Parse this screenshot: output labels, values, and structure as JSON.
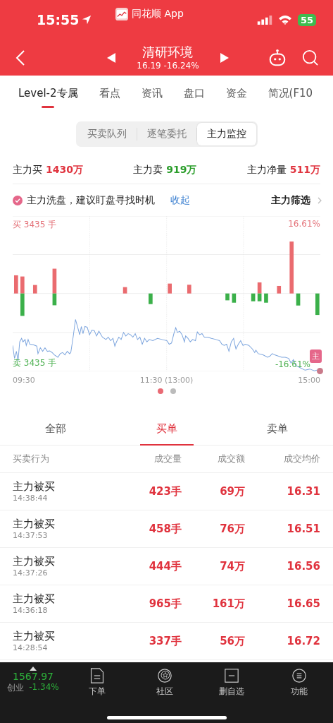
{
  "status_bar": {
    "time": "15:55",
    "app_name": "同花顺 App",
    "battery": "55"
  },
  "header": {
    "title": "清研环境",
    "price": "16.19",
    "change": "-16.24%"
  },
  "tabs": [
    {
      "label": "Level-2专属",
      "selected": true
    },
    {
      "label": "看点",
      "selected": false
    },
    {
      "label": "资讯",
      "selected": false
    },
    {
      "label": "盘口",
      "selected": false
    },
    {
      "label": "资金",
      "selected": false
    },
    {
      "label": "简况(F10",
      "selected": false
    }
  ],
  "segments": [
    {
      "label": "买卖队列",
      "selected": false
    },
    {
      "label": "逐笔委托",
      "selected": false
    },
    {
      "label": "主力监控",
      "selected": true
    }
  ],
  "summary": [
    {
      "label": "主力买",
      "value": "1430万",
      "color": "#e0333e"
    },
    {
      "label": "主力卖",
      "value": "919万",
      "color": "#2a9d2a"
    },
    {
      "label": "主力净量",
      "value": "511万",
      "color": "#e0333e"
    }
  ],
  "tip": {
    "text": "主力洗盘，建议盯盘寻找时机",
    "link": "收起",
    "filter": "主力筛选"
  },
  "chart": {
    "buy_label": "买 3435 手",
    "top_pct": "16.61%",
    "sell_label": "卖 3435 手",
    "bottom_pct": "-16.61%",
    "badge": "主",
    "x_labels": [
      "09:30",
      "11:30 (13:00)",
      "15:00"
    ]
  },
  "chart_pager": [
    {
      "selected": true
    },
    {
      "selected": false
    }
  ],
  "list_tabs": [
    {
      "label": "全部",
      "selected": false
    },
    {
      "label": "买单",
      "selected": true
    },
    {
      "label": "卖单",
      "selected": false
    }
  ],
  "table": {
    "columns": [
      "买卖行为",
      "成交量",
      "成交额",
      "成交均价"
    ],
    "rows": [
      {
        "action": "主力被买",
        "time": "14:38:44",
        "volume": "423手",
        "amount": "69万",
        "price": "16.31"
      },
      {
        "action": "主力被买",
        "time": "14:37:53",
        "volume": "458手",
        "amount": "76万",
        "price": "16.51"
      },
      {
        "action": "主力被买",
        "time": "14:37:26",
        "volume": "444手",
        "amount": "74万",
        "price": "16.56"
      },
      {
        "action": "主力被买",
        "time": "14:36:18",
        "volume": "965手",
        "amount": "161万",
        "price": "16.65"
      },
      {
        "action": "主力被买",
        "time": "14:28:54",
        "volume": "337手",
        "amount": "56万",
        "price": "16.72"
      }
    ]
  },
  "bottom_bar": {
    "index": {
      "value": "1567.97",
      "name": "创业",
      "change": "-1.34%"
    },
    "items": [
      {
        "label": "下单",
        "kind": "order"
      },
      {
        "label": "社区",
        "kind": "community"
      },
      {
        "label": "删自选",
        "kind": "remove"
      },
      {
        "label": "功能",
        "kind": "menu"
      }
    ]
  }
}
